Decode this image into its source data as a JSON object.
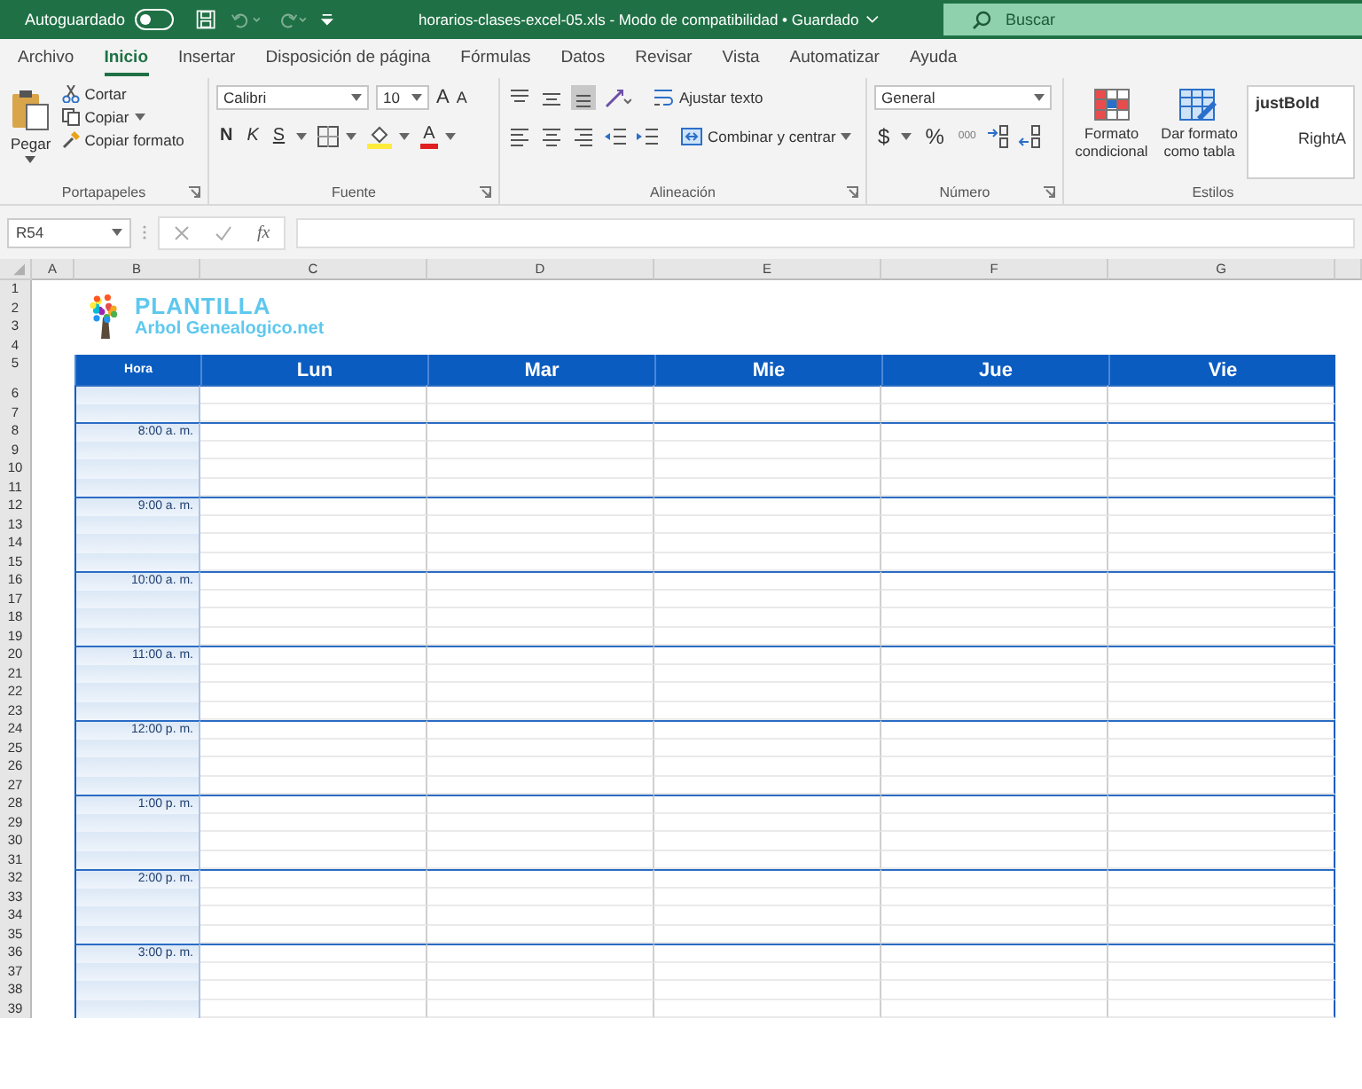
{
  "title_bar": {
    "autosave_label": "Autoguardado",
    "autosave_on": false,
    "file_title": "horarios-clases-excel-05.xls  -  Modo de compatibilidad • Guardado",
    "search_placeholder": "Buscar"
  },
  "tabs": [
    {
      "label": "Archivo",
      "selected": false
    },
    {
      "label": "Inicio",
      "selected": true
    },
    {
      "label": "Insertar",
      "selected": false
    },
    {
      "label": "Disposición de página",
      "selected": false
    },
    {
      "label": "Fórmulas",
      "selected": false
    },
    {
      "label": "Datos",
      "selected": false
    },
    {
      "label": "Revisar",
      "selected": false
    },
    {
      "label": "Vista",
      "selected": false
    },
    {
      "label": "Automatizar",
      "selected": false
    },
    {
      "label": "Ayuda",
      "selected": false
    }
  ],
  "ribbon": {
    "clipboard": {
      "paste": "Pegar",
      "cut": "Cortar",
      "copy": "Copiar",
      "format_painter": "Copiar formato",
      "group": "Portapapeles"
    },
    "font": {
      "font_name": "Calibri",
      "font_size": "10",
      "grow": "A",
      "shrink": "A",
      "bold": "N",
      "italic": "K",
      "underline": "S",
      "font_color": "A",
      "group": "Fuente"
    },
    "alignment": {
      "wrap": "Ajustar texto",
      "merge": "Combinar y centrar",
      "group": "Alineación"
    },
    "number": {
      "format": "General",
      "currency": "$",
      "percent": "%",
      "thousands": "000",
      "group": "Número"
    },
    "styles": {
      "conditional": "Formato condicional",
      "as_table": "Dar formato como tabla",
      "gallery": [
        "justBold",
        "RightA"
      ],
      "group": "Estilos"
    }
  },
  "formula_bar": {
    "name_box": "R54",
    "function_label": "fx"
  },
  "sheet": {
    "column_headers": [
      "A",
      "B",
      "C",
      "D",
      "E",
      "F",
      "G"
    ],
    "row_numbers": [
      "1",
      "2",
      "3",
      "4",
      "5",
      "6",
      "7",
      "8",
      "9",
      "10",
      "11",
      "12",
      "13",
      "14",
      "15",
      "16",
      "17",
      "18",
      "19",
      "20",
      "21",
      "22",
      "23",
      "24",
      "25",
      "26",
      "27",
      "28",
      "29",
      "30",
      "31",
      "32",
      "33",
      "34",
      "35",
      "36",
      "37",
      "38",
      "39"
    ],
    "logo": {
      "line1": "PLANTILLA",
      "line2": "Arbol Genealogico.net"
    },
    "schedule": {
      "corner": "Hora",
      "days": [
        "Lun",
        "Mar",
        "Mie",
        "Jue",
        "Vie"
      ],
      "slots": [
        {
          "time": "8:00 a. m."
        },
        {
          "time": "9:00 a. m."
        },
        {
          "time": "10:00 a. m."
        },
        {
          "time": "11:00 a. m."
        },
        {
          "time": "12:00 p. m."
        },
        {
          "time": "1:00 p. m."
        },
        {
          "time": "2:00 p. m."
        },
        {
          "time": "3:00 p. m."
        }
      ]
    }
  }
}
